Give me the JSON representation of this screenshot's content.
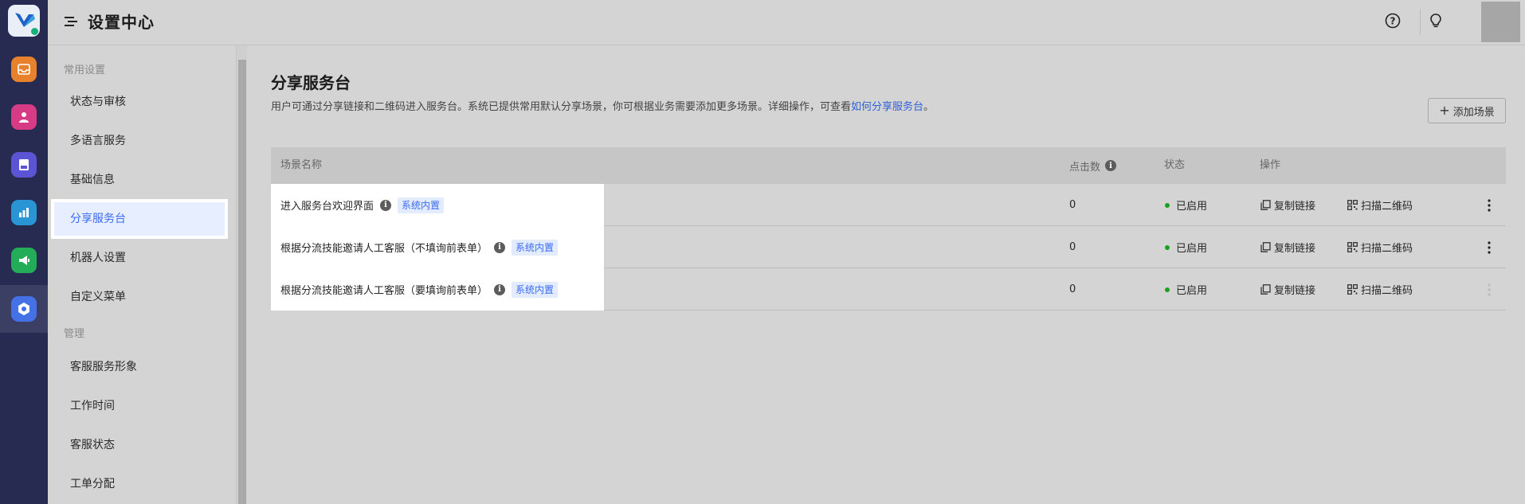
{
  "app": {
    "title": "设置中心",
    "brand_color": "#272b52",
    "accent": "#3b6cf0"
  },
  "rail": {
    "icons": [
      {
        "name": "inbox-icon",
        "color": "#e8812c"
      },
      {
        "name": "contact-icon",
        "color": "#d83b86"
      },
      {
        "name": "ticket-icon",
        "color": "#5b55d6"
      },
      {
        "name": "analytics-icon",
        "color": "#2a95d4"
      },
      {
        "name": "marketing-icon",
        "color": "#24ad59"
      },
      {
        "name": "settings-icon",
        "color": "#4571e6"
      }
    ]
  },
  "header": {
    "help_icon": "help-icon",
    "idea_icon": "lightbulb-icon"
  },
  "sidebar": {
    "groups": [
      {
        "label": "常用设置"
      },
      {
        "label": "管理"
      }
    ],
    "items": [
      {
        "label": "状态与审核"
      },
      {
        "label": "多语言服务"
      },
      {
        "label": "基础信息"
      },
      {
        "label": "分享服务台",
        "active": true
      },
      {
        "label": "机器人设置"
      },
      {
        "label": "自定义菜单"
      },
      {
        "label": "客服服务形象"
      },
      {
        "label": "工作时间"
      },
      {
        "label": "客服状态"
      },
      {
        "label": "工单分配"
      }
    ]
  },
  "main": {
    "title": "分享服务台",
    "description": "用户可通过分享链接和二维码进入服务台。系统已提供常用默认分享场景，你可根据业务需要添加更多场景。详细操作，可查看",
    "description_link": "如何分享服务台",
    "description_end": "。",
    "add_button": "添加场景",
    "table": {
      "headers": {
        "name": "场景名称",
        "clicks": "点击数",
        "status": "状态",
        "actions": "操作"
      },
      "rows": [
        {
          "name": "进入服务台欢迎界面",
          "tag": "系统内置",
          "clicks": "0",
          "status": "已启用",
          "copy": "复制链接",
          "qr": "扫描二维码"
        },
        {
          "name": "根据分流技能邀请人工客服（不填询前表单）",
          "tag": "系统内置",
          "clicks": "0",
          "status": "已启用",
          "copy": "复制链接",
          "qr": "扫描二维码"
        },
        {
          "name": "根据分流技能邀请人工客服（要填询前表单）",
          "tag": "系统内置",
          "clicks": "0",
          "status": "已启用",
          "copy": "复制链接",
          "qr": "扫描二维码"
        }
      ]
    }
  }
}
